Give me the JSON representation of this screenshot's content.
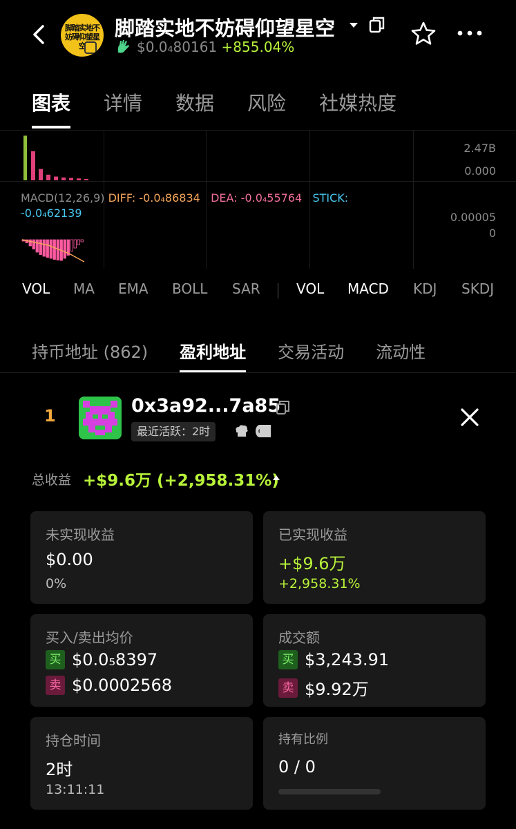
{
  "header": {
    "logo_text": "脚踏实地不妨碍仰望星空",
    "title": "脚踏实地不妨碍仰望星空",
    "price": "$0.0₄80161",
    "change": "+855.04%"
  },
  "tabs": [
    "图表",
    "详情",
    "数据",
    "风险",
    "社媒热度"
  ],
  "chart": {
    "vol_labels": [
      "2.47B",
      "0.000"
    ],
    "macd_title": "MACD(12,26,9)",
    "diff": "DIFF: -0.0₄86834",
    "dea": "DEA: -0.0₄55764",
    "stick": "STICK:",
    "stick_val": "-0.0₄62139",
    "macd_labels": [
      "0.00005",
      "0"
    ],
    "volume_bars": [
      0.95,
      0.62,
      0.24,
      0.12,
      0.08,
      0.06,
      0.05,
      0.04,
      0.03
    ],
    "macd_bars": [
      0.05,
      0.15,
      0.3,
      0.45,
      0.6,
      0.72,
      0.8,
      0.85,
      0.9,
      0.95,
      0.98,
      1.0,
      0.9,
      0.75,
      0.55,
      0.4,
      0.25,
      0.1
    ],
    "colors": {
      "vol_green": "#8fbf3a",
      "vol_pink": "#e0407a",
      "macd_pink": "#ff5aa0",
      "diff_orange": "#f5a55a",
      "dea_pink": "#f06e9a",
      "stick_cyan": "#49c8f0"
    }
  },
  "indicators": {
    "main": [
      "VOL",
      "MA",
      "EMA",
      "BOLL",
      "SAR"
    ],
    "sub": [
      "VOL",
      "MACD",
      "KDJ",
      "SKDJ"
    ]
  },
  "sub_tabs": [
    "持币地址 (862)",
    "盈利地址",
    "交易活动",
    "流动性"
  ],
  "holder": {
    "rank": "1",
    "address": "0x3a92...7a85",
    "last_active": "最近活跃：2时",
    "total_label": "总收益",
    "total_value": "+$9.6万 (+2,958.31%)"
  },
  "cards": {
    "unrealized": {
      "label": "未实现收益",
      "value": "$0.00",
      "pct": "0%"
    },
    "realized": {
      "label": "已实现收益",
      "value": "+$9.6万",
      "pct": "+2,958.31%"
    },
    "avg_price": {
      "label": "买入/卖出均价",
      "buy_tag": "买",
      "buy": "$0.0₅8397",
      "sell_tag": "卖",
      "sell": "$0.0002568"
    },
    "volume": {
      "label": "成交额",
      "buy_tag": "买",
      "buy": "$3,243.91",
      "sell_tag": "卖",
      "sell": "$9.92万"
    },
    "hold_time": {
      "label": "持仓时间",
      "value": "2时",
      "time": "13:11:11"
    },
    "hold_ratio": {
      "label": "持有比例",
      "value": "0 / 0"
    }
  }
}
